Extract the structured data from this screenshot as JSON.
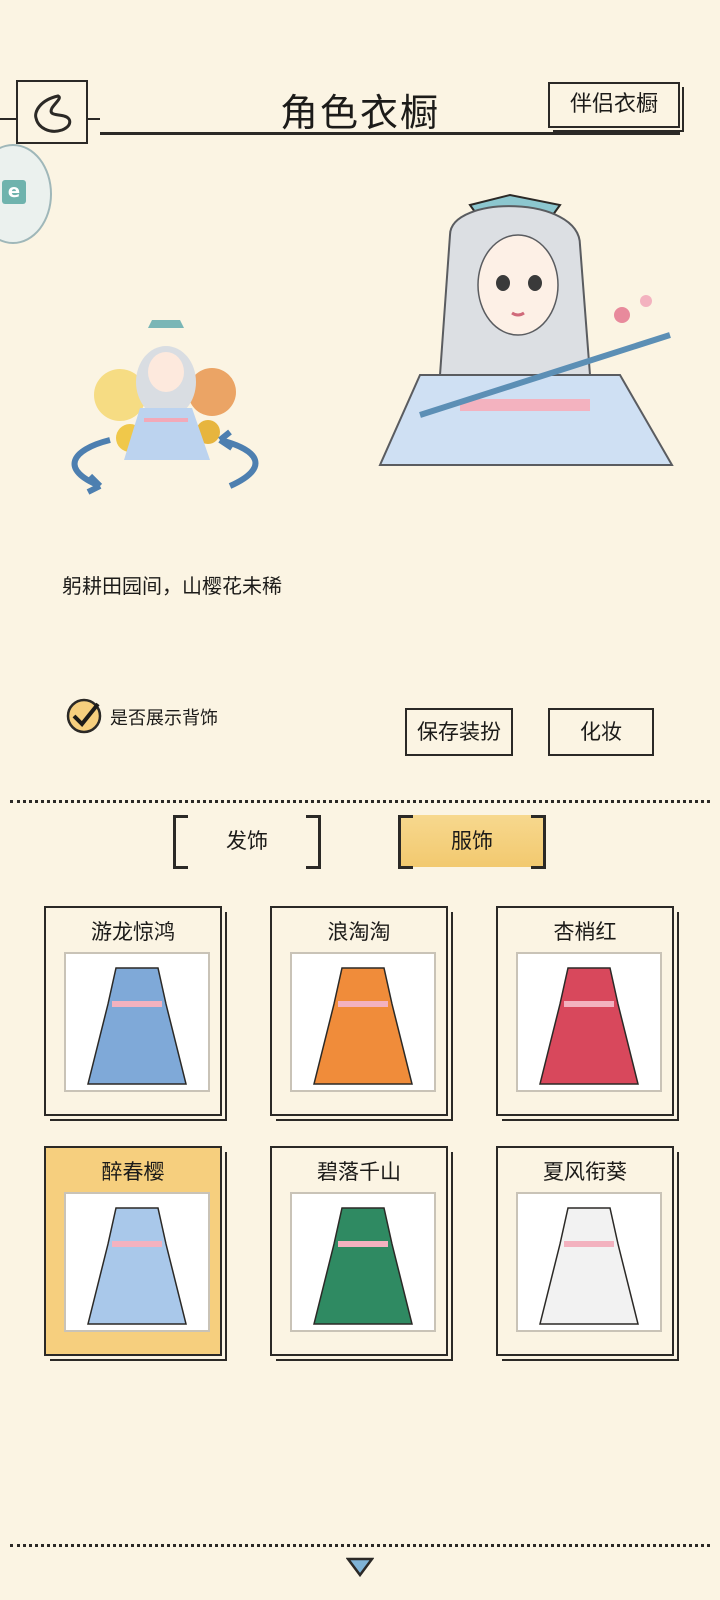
{
  "header": {
    "title": "角色衣橱",
    "partner_button": "伴侣衣橱"
  },
  "character": {
    "quote": "躬耕田园间，山樱花未稀"
  },
  "options": {
    "show_back_accessory": "是否展示背饰",
    "checked": true,
    "save_button": "保存装扮",
    "makeup_button": "化妆"
  },
  "tabs": [
    {
      "label": "发饰",
      "active": false
    },
    {
      "label": "服饰",
      "active": true
    }
  ],
  "outfits": [
    {
      "name": "游龙惊鸿",
      "color": "#7fa9d8",
      "selected": false
    },
    {
      "name": "浪淘淘",
      "color": "#f08c3a",
      "selected": false
    },
    {
      "name": "杏梢红",
      "color": "#d8485c",
      "selected": false
    },
    {
      "name": "醉春樱",
      "color": "#a9c8ea",
      "selected": true
    },
    {
      "name": "碧落千山",
      "color": "#2f8a62",
      "selected": false
    },
    {
      "name": "夏风衔葵",
      "color": "#f2f2f2",
      "selected": false
    }
  ],
  "colors": {
    "background": "#fbf4e3",
    "selected_card": "#f6cf7e",
    "ink": "#2b2926"
  }
}
